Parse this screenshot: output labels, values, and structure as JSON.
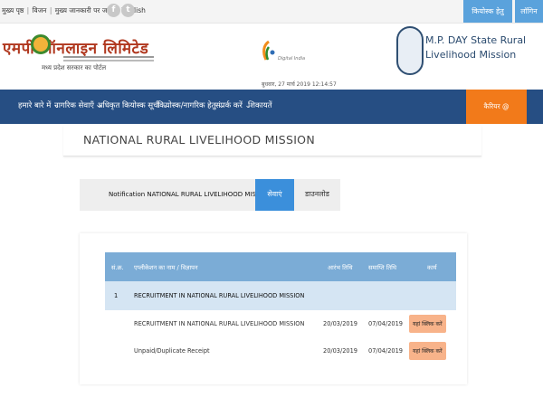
{
  "topbar": {
    "links": [
      "मुख्य पृष्ठ",
      "विजन",
      "मुख्य जानकारी पर जाएँ",
      "English"
    ],
    "kiosk_button": "कियोस्क हेतु आवेदन",
    "login_button": "लॉगिन",
    "facebook_glyph": "f",
    "twitter_glyph": "t"
  },
  "header": {
    "logo_text": "एमपी ऑनलाइन लिमिटेड",
    "logo_tagline": "मध्य प्रदेश सरकार का पोर्टल",
    "digital_india_text": "Digital India",
    "datetime": "बुधवार, 27 मार्च 2019 12:14:57",
    "mp_title_line1": "M.P. DAY State Rural",
    "mp_title_line2": "Livelihood Mission"
  },
  "nav": {
    "items": [
      "हमारे बारे में",
      "नागरिक सेवाएँ",
      "अधिकृत कियोस्क सूची",
      "कियोस्क/नागरिक हेतु",
      "संपर्क करें",
      "शिकायतें"
    ],
    "career_button": "कैरियर @ एमपीऑनलाइन"
  },
  "page": {
    "title": "NATIONAL RURAL LIVELIHOOD MISSION"
  },
  "notification": {
    "label": "Notification NATIONAL RURAL LIVELIHOOD MISSION",
    "tab_active": "सेवाएं",
    "tab_download": "डाउनलोड"
  },
  "table": {
    "headers": [
      "सं.क्र.",
      "एप्लीकेशन का नाम / विज्ञापन",
      "आरंभ तिथि",
      "समाप्ति तिथि",
      "कार्य"
    ],
    "group": {
      "num": "1",
      "name": "RECRUITMENT IN NATIONAL RURAL LIVELIHOOD MISSION"
    },
    "rows": [
      {
        "name": "RECRUITMENT IN NATIONAL RURAL LIVELIHOOD MISSION",
        "start": "20/03/2019",
        "end": "07/04/2019",
        "action": "यहां क्लिक करें"
      },
      {
        "name": "Unpaid/Duplicate Receipt",
        "start": "20/03/2019",
        "end": "07/04/2019",
        "action": "यहां क्लिक करें"
      }
    ]
  },
  "colors": {
    "nav_bg": "#264e83",
    "career_orange": "#f27a1a",
    "table_header": "#7bacd6",
    "action_button": "#f8b38a",
    "active_tab": "#3b8fdb"
  }
}
